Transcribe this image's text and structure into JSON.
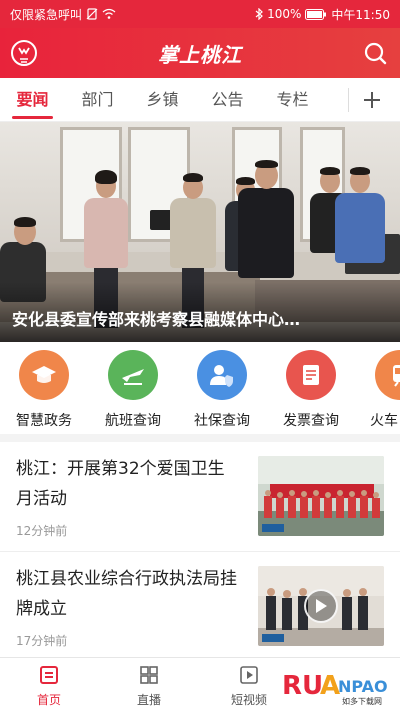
{
  "status_bar": {
    "carrier": "仅限紧急呼叫",
    "battery": "100%",
    "time": "中午11:50"
  },
  "header": {
    "title": "掌上桃江"
  },
  "tabs": [
    {
      "label": "要闻",
      "active": true
    },
    {
      "label": "部门",
      "active": false
    },
    {
      "label": "乡镇",
      "active": false
    },
    {
      "label": "公告",
      "active": false
    },
    {
      "label": "专栏",
      "active": false
    }
  ],
  "banner": {
    "caption": "安化县委宣传部来桃考察县融媒体中心…"
  },
  "services": [
    {
      "label": "智慧政务",
      "icon": "graduation-cap-icon",
      "color": "#f0864a"
    },
    {
      "label": "航班查询",
      "icon": "airplane-icon",
      "color": "#5ab45a"
    },
    {
      "label": "社保查询",
      "icon": "person-shield-icon",
      "color": "#4a90e2"
    },
    {
      "label": "发票查询",
      "icon": "invoice-icon",
      "color": "#e8554e"
    },
    {
      "label": "火车",
      "icon": "train-icon",
      "color": "#f0864a"
    }
  ],
  "news": [
    {
      "title": "桃江：开展第32个爱国卫生月活动",
      "time": "12分钟前"
    },
    {
      "title": "桃江县农业综合行政执法局挂牌成立",
      "time": "17分钟前"
    }
  ],
  "bottom_nav": [
    {
      "label": "首页",
      "icon": "home-icon",
      "active": true
    },
    {
      "label": "直播",
      "icon": "grid-icon",
      "active": false
    },
    {
      "label": "短视频",
      "icon": "video-icon",
      "active": false
    }
  ],
  "watermark": {
    "brand": "RUANPAO",
    "sub": "如多下载网"
  },
  "colors": {
    "brand_red": "#e5273c"
  }
}
